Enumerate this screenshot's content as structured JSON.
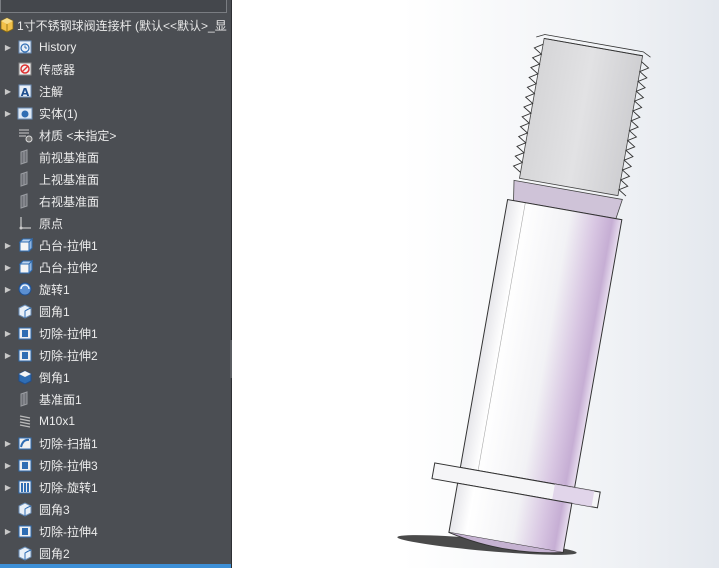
{
  "feature_tree": {
    "root": {
      "label": "1寸不锈钢球阀连接杆  (默认<<默认>_显",
      "icon": "part-icon"
    },
    "items": [
      {
        "label": "History",
        "icon": "history-icon",
        "expandable": true
      },
      {
        "label": "传感器",
        "icon": "sensor-icon",
        "expandable": false
      },
      {
        "label": "注解",
        "icon": "annotation-icon",
        "expandable": true
      },
      {
        "label": "实体(1)",
        "icon": "solid-body-icon",
        "expandable": true
      },
      {
        "label": "材质 <未指定>",
        "icon": "material-icon",
        "expandable": false
      },
      {
        "label": "前视基准面",
        "icon": "plane-icon",
        "expandable": false
      },
      {
        "label": "上视基准面",
        "icon": "plane-icon",
        "expandable": false
      },
      {
        "label": "右视基准面",
        "icon": "plane-icon",
        "expandable": false
      },
      {
        "label": "原点",
        "icon": "origin-icon",
        "expandable": false
      },
      {
        "label": "凸台-拉伸1",
        "icon": "boss-extrude-icon",
        "expandable": true
      },
      {
        "label": "凸台-拉伸2",
        "icon": "boss-extrude-icon",
        "expandable": true
      },
      {
        "label": "旋转1",
        "icon": "revolve-icon",
        "expandable": true
      },
      {
        "label": "圆角1",
        "icon": "fillet-icon",
        "expandable": false
      },
      {
        "label": "切除-拉伸1",
        "icon": "cut-extrude-icon",
        "expandable": true
      },
      {
        "label": "切除-拉伸2",
        "icon": "cut-extrude-icon",
        "expandable": true
      },
      {
        "label": "倒角1",
        "icon": "chamfer-icon",
        "expandable": false
      },
      {
        "label": "基准面1",
        "icon": "plane-icon",
        "expandable": false
      },
      {
        "label": "M10x1",
        "icon": "thread-icon",
        "expandable": false
      },
      {
        "label": "切除-扫描1",
        "icon": "cut-sweep-icon",
        "expandable": true
      },
      {
        "label": "切除-拉伸3",
        "icon": "cut-extrude-icon",
        "expandable": true
      },
      {
        "label": "切除-旋转1",
        "icon": "cut-revolve-icon",
        "expandable": true
      },
      {
        "label": "圆角3",
        "icon": "fillet-icon",
        "expandable": false
      },
      {
        "label": "切除-拉伸4",
        "icon": "cut-extrude-icon",
        "expandable": true
      },
      {
        "label": "圆角2",
        "icon": "fillet-icon",
        "expandable": false
      }
    ]
  },
  "colors": {
    "sidebar_bg": "#4b4e53",
    "tree_text": "#ececec",
    "selection_accent": "#3d8fd6",
    "model_body": "#f4f4f6",
    "model_shade": "#c9b3d6",
    "thread": "#d8d8d8"
  }
}
